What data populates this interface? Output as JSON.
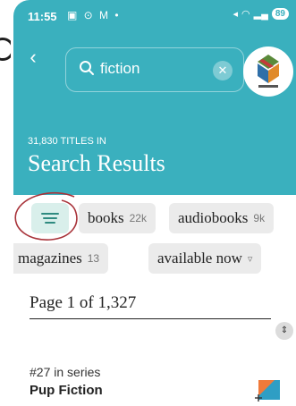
{
  "status_bar": {
    "time": "11:55",
    "notification_icons": "▣ ⊙ M •",
    "battery": "89"
  },
  "search": {
    "query": "fiction",
    "clear_label": "✕"
  },
  "results": {
    "count_text": "31,830 TITLES IN",
    "title": "Search Results"
  },
  "filters": {
    "chips": [
      {
        "label": "books",
        "count": "22k"
      },
      {
        "label": "audiobooks",
        "count": "9k"
      },
      {
        "label": "magazines",
        "count": "13"
      },
      {
        "label": "available now",
        "count": ""
      }
    ]
  },
  "pagination": {
    "label": "Page 1 of 1,327"
  },
  "list": {
    "first_item": {
      "series": "#27 in series",
      "title": "Pup Fiction"
    }
  },
  "colors": {
    "header_teal": "#3ab0be",
    "filter_active_bg": "#d9efeb",
    "annotation_circle": "#a8333a",
    "chip_bg": "#ebebeb"
  },
  "icons": {
    "back": "chevron-left-icon",
    "search": "search-icon",
    "clear": "clear-icon",
    "filter": "filter-icon",
    "available_now": "filter-small-icon",
    "stepper": "up-down-icon",
    "add": "add-icon"
  }
}
